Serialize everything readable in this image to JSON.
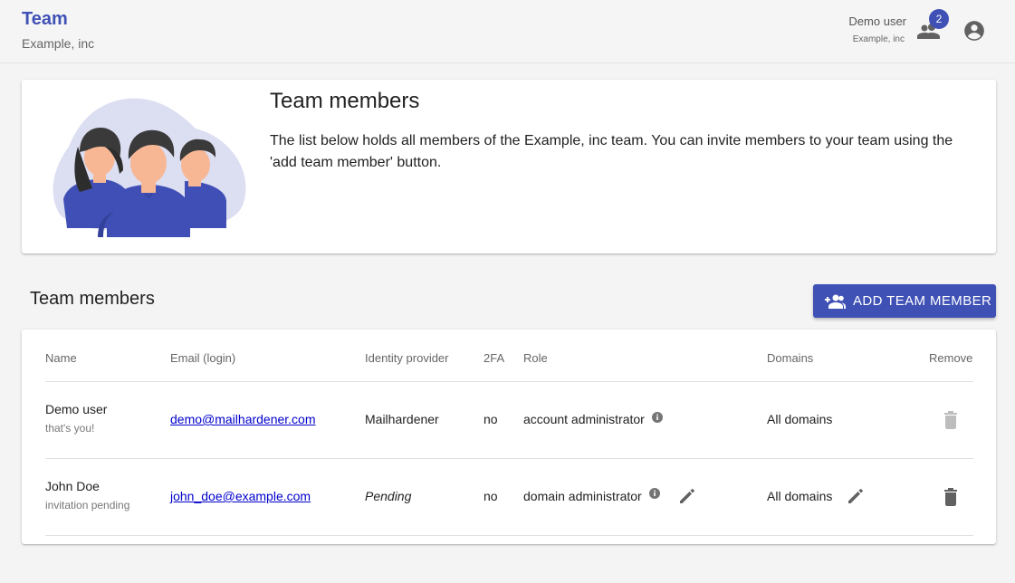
{
  "header": {
    "title": "Team",
    "subtitle": "Example, inc",
    "user_name": "Demo user",
    "user_org": "Example, inc",
    "team_badge": "2"
  },
  "intro": {
    "title": "Team members",
    "text": "The list below holds all members of the Example, inc team. You can invite members to your team using the 'add team member' button."
  },
  "section": {
    "title": "Team members",
    "add_button": "ADD TEAM MEMBER"
  },
  "table": {
    "columns": [
      "Name",
      "Email (login)",
      "Identity provider",
      "2FA",
      "Role",
      "Domains",
      "Remove"
    ],
    "rows": [
      {
        "name": "Demo user",
        "note": "that's you!",
        "email": "demo@mailhardener.com",
        "provider": "Mailhardener",
        "twofa": "no",
        "role": "account administrator",
        "domains": "All domains"
      },
      {
        "name": "John Doe",
        "note": "invitation pending",
        "email": "john_doe@example.com",
        "provider": "Pending",
        "twofa": "no",
        "role": "domain administrator",
        "domains": "All domains"
      }
    ]
  },
  "colors": {
    "accent": "#3f51b5",
    "illustration_bg": "#dcdef2",
    "disabled_icon": "#bdbdbd"
  },
  "icons": [
    "team-icon",
    "account-circle-icon",
    "group-add-icon",
    "info-icon",
    "edit-icon",
    "trash-icon"
  ]
}
